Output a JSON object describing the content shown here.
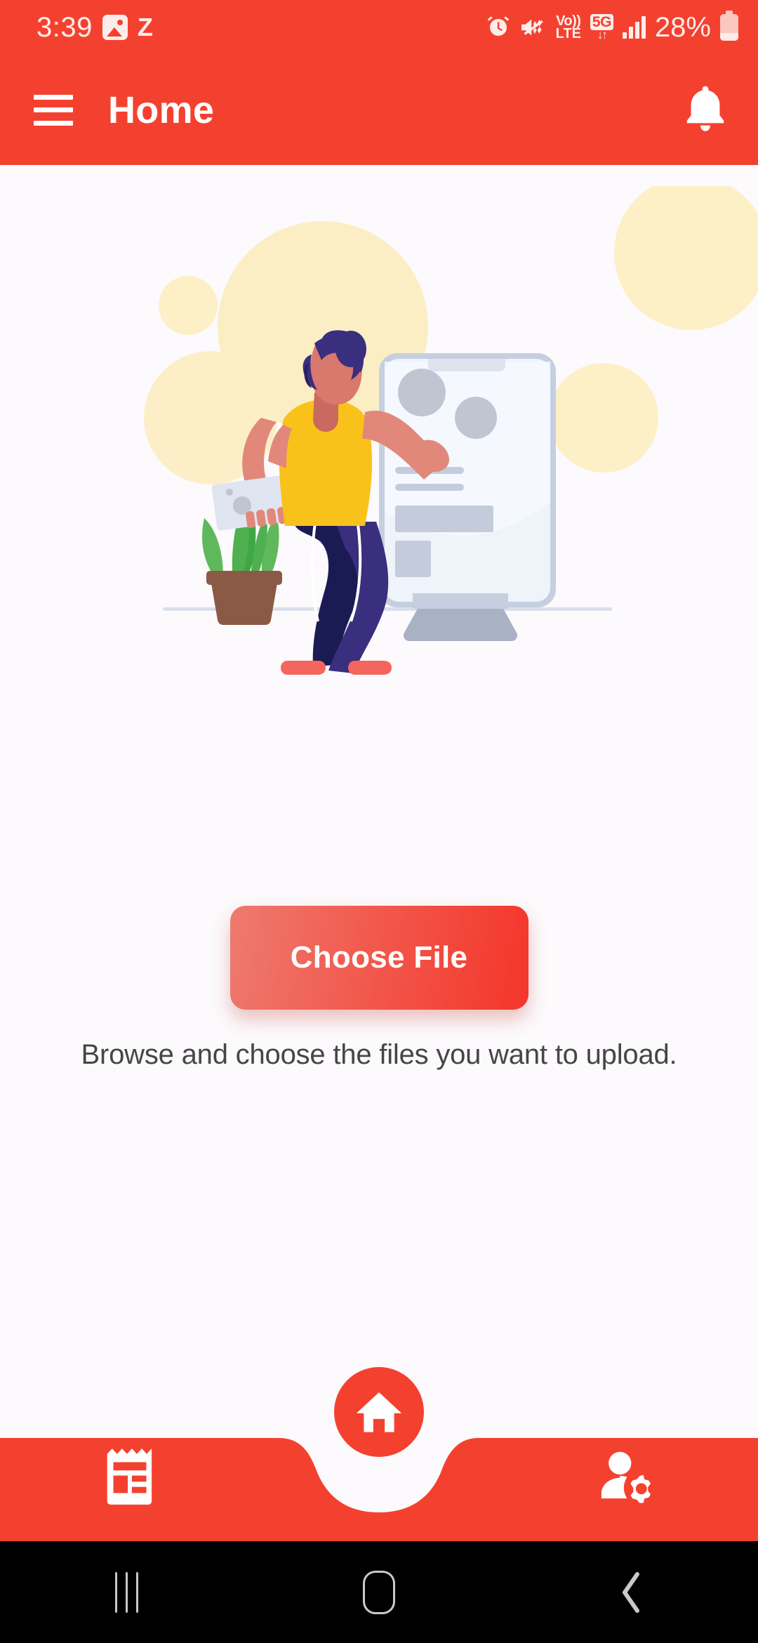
{
  "status_bar": {
    "time": "3:39",
    "left_icons": [
      "photo-icon",
      "z-icon"
    ],
    "right_icons": [
      "alarm-icon",
      "mute-vibrate-icon",
      "volte-icon",
      "fiveg-icon",
      "signal-icon"
    ],
    "volte_top": "Vo))",
    "volte_bottom": "LTE",
    "network_label": "5G",
    "battery_percent": "28%"
  },
  "app_bar": {
    "title": "Home",
    "menu_icon": "hamburger-menu-icon",
    "notification_icon": "bell-icon",
    "background_color": "#F4412F"
  },
  "main": {
    "illustration_name": "person-uploading-files-illustration",
    "button_label": "Choose File",
    "hint_text": "Browse and choose the files you want to upload.",
    "button_gradient_start": "#EE7A70",
    "button_gradient_end": "#F4352A",
    "background_color": "#FCFAFC"
  },
  "bottom_nav": {
    "background_color": "#F4412F",
    "items": [
      {
        "name": "news-icon",
        "label": ""
      },
      {
        "name": "home-icon",
        "label": "",
        "active": true
      },
      {
        "name": "user-settings-icon",
        "label": ""
      }
    ]
  },
  "system_nav": {
    "recents_label": "recents-icon",
    "home_label": "home-icon",
    "back_label": "back-icon"
  }
}
